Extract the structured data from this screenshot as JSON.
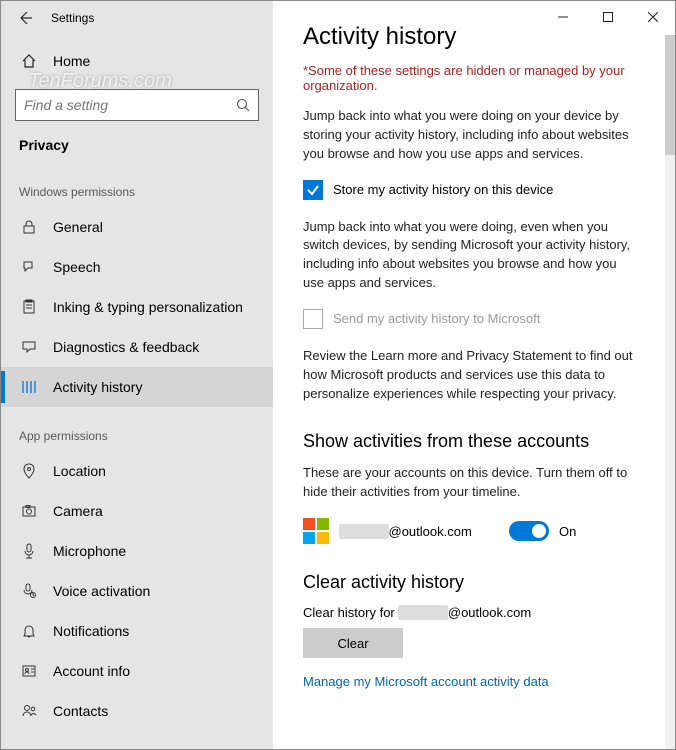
{
  "window": {
    "title": "Settings"
  },
  "winControls": {
    "min": "—",
    "max": "▢",
    "close": "✕"
  },
  "home": {
    "label": "Home"
  },
  "search": {
    "placeholder": "Find a setting"
  },
  "category": "Privacy",
  "sections": {
    "windows": "Windows permissions",
    "app": "App permissions"
  },
  "nav": {
    "general": "General",
    "speech": "Speech",
    "inking": "Inking & typing personalization",
    "diagnostics": "Diagnostics & feedback",
    "activity": "Activity history",
    "location": "Location",
    "camera": "Camera",
    "microphone": "Microphone",
    "voice": "Voice activation",
    "notifications": "Notifications",
    "account": "Account info",
    "contacts": "Contacts"
  },
  "page": {
    "title": "Activity history",
    "warning": "*Some of these settings are hidden or managed by your organization.",
    "intro1": "Jump back into what you were doing on your device by storing your activity history, including info about websites you browse and how you use apps and services.",
    "storeCheck": "Store my activity history on this device",
    "intro2": "Jump back into what you were doing, even when you switch devices, by sending Microsoft your activity history, including info about websites you browse and how you use apps and services.",
    "sendCheck": "Send my activity history to Microsoft",
    "review": "Review the Learn more and Privacy Statement to find out how Microsoft products and services use this data to personalize experiences while respecting your privacy.",
    "accountsHeader": "Show activities from these accounts",
    "accountsDesc": "These are your accounts on this device. Turn them off to hide their activities from your timeline.",
    "accountSuffix": "@outlook.com",
    "toggleState": "On",
    "clearHeader": "Clear activity history",
    "clearPrefix": "Clear history for ",
    "clearSuffix": "@outlook.com",
    "clearBtn": "Clear",
    "manageLink": "Manage my Microsoft account activity data"
  },
  "watermark": "TenForums.com"
}
